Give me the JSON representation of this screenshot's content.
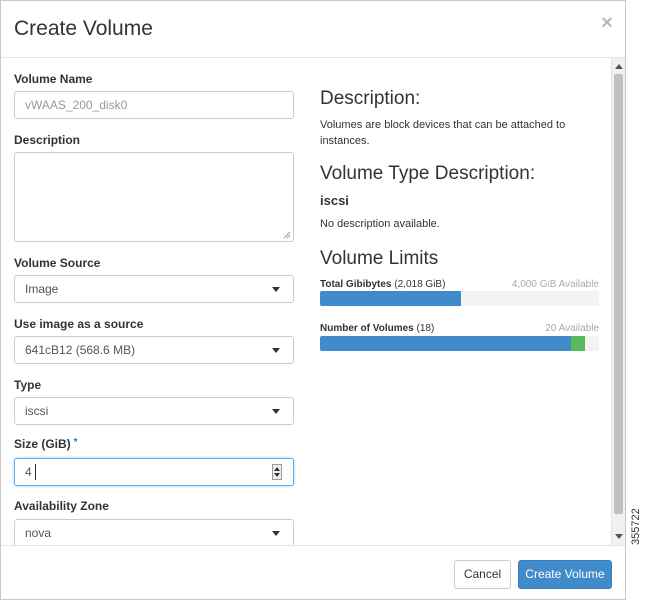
{
  "modal": {
    "title": "Create Volume",
    "close_symbol": "×"
  },
  "form": {
    "volume_name": {
      "label": "Volume Name",
      "value": "vWAAS_200_disk0"
    },
    "description": {
      "label": "Description",
      "value": ""
    },
    "volume_source": {
      "label": "Volume Source",
      "value": "Image"
    },
    "image_source": {
      "label": "Use image as a source",
      "value": "641cB12 (568.6 MB)"
    },
    "type": {
      "label": "Type",
      "value": "iscsi"
    },
    "size": {
      "label": "Size (GiB)",
      "required_mark": "*",
      "value": "4"
    },
    "availability_zone": {
      "label": "Availability Zone",
      "value": "nova"
    }
  },
  "info": {
    "description_heading": "Description:",
    "description_text": "Volumes are block devices that can be attached to instances.",
    "type_heading": "Volume Type Description:",
    "type_name": "iscsi",
    "type_text": "No description available.",
    "limits_heading": "Volume Limits",
    "limits": [
      {
        "label": "Total Gibibytes",
        "detail": "(2,018 GiB)",
        "available": "4,000 GiB Available",
        "used_fraction": 0.504,
        "added_fraction": 0.0
      },
      {
        "label": "Number of Volumes",
        "detail": "(18)",
        "available": "20 Available",
        "used_fraction": 0.9,
        "added_fraction": 0.05
      }
    ]
  },
  "footer": {
    "cancel_label": "Cancel",
    "submit_label": "Create Volume"
  },
  "figure_id": "355722",
  "colors": {
    "primary": "#428bca",
    "bar_used": "#428bca",
    "bar_added": "#5cb85c"
  }
}
